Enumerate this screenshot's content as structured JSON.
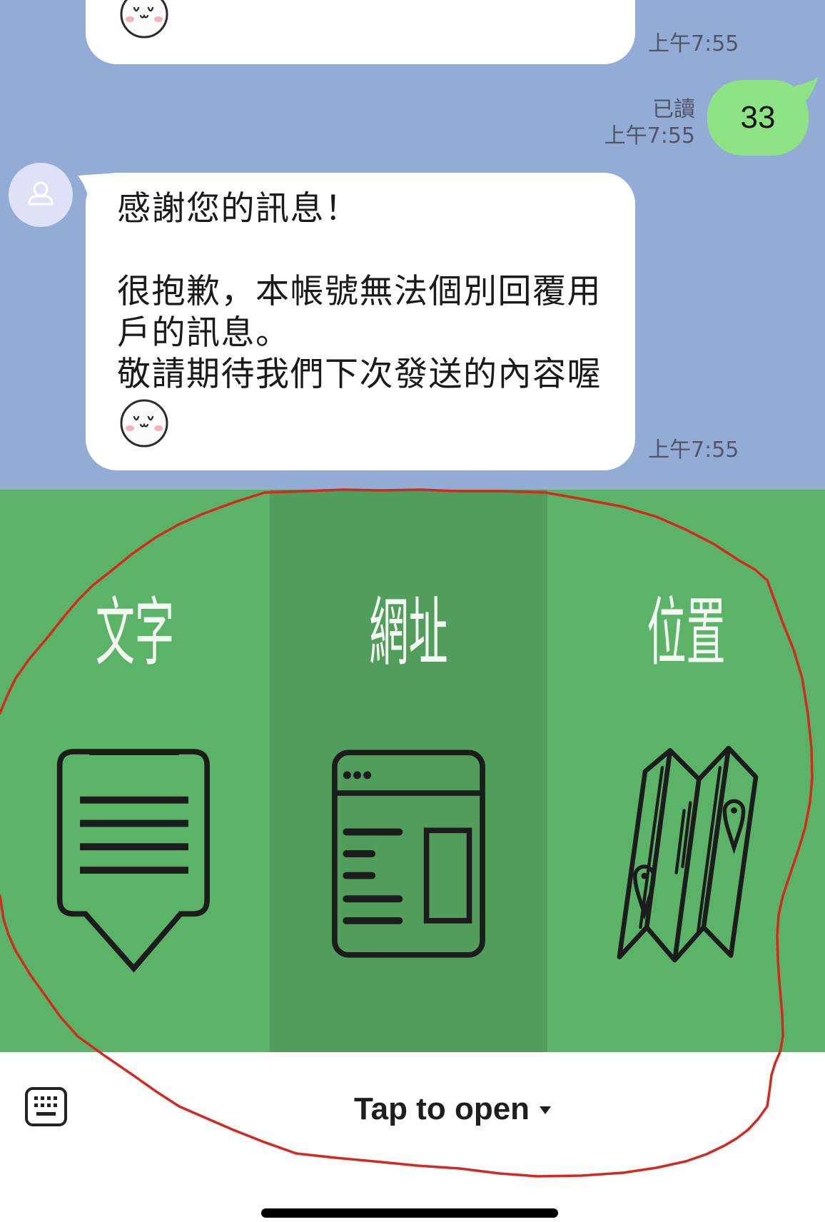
{
  "chat": {
    "top_message": {
      "emoji": "smiling-face-emoji",
      "time": "上午7:55"
    },
    "sent_message": {
      "text": "33",
      "read_status": "已讀",
      "time": "上午7:55"
    },
    "received_message": {
      "avatar_icon": "default-user-icon",
      "greeting": "感謝您的訊息！",
      "lines": [
        "很抱歉，本帳號無法個別回覆用",
        "戶的訊息。",
        "敬請期待我們下次發送的內容喔"
      ],
      "emoji": "smiling-face-emoji",
      "time": "上午7:55"
    }
  },
  "rich_menu": {
    "items": [
      {
        "label": "文字",
        "icon": "speech-bubble-icon"
      },
      {
        "label": "網址",
        "icon": "browser-window-icon"
      },
      {
        "label": "位置",
        "icon": "folded-map-icon"
      }
    ]
  },
  "bottom_bar": {
    "keyboard_icon": "keyboard-icon",
    "menu_toggle_label": "Tap to open",
    "toggle_icon": "caret-down-icon"
  },
  "colors": {
    "chat_background": "#93acd6",
    "sent_bubble": "#8de383",
    "received_bubble": "#ffffff",
    "avatar_background": "#dfe2f7",
    "menu_green": "#5bb368",
    "menu_green_active": "#519e5c",
    "menu_label": "#f4f8f2",
    "icon_stroke": "#1c1c1c",
    "annotation_red": "#d4291f"
  }
}
